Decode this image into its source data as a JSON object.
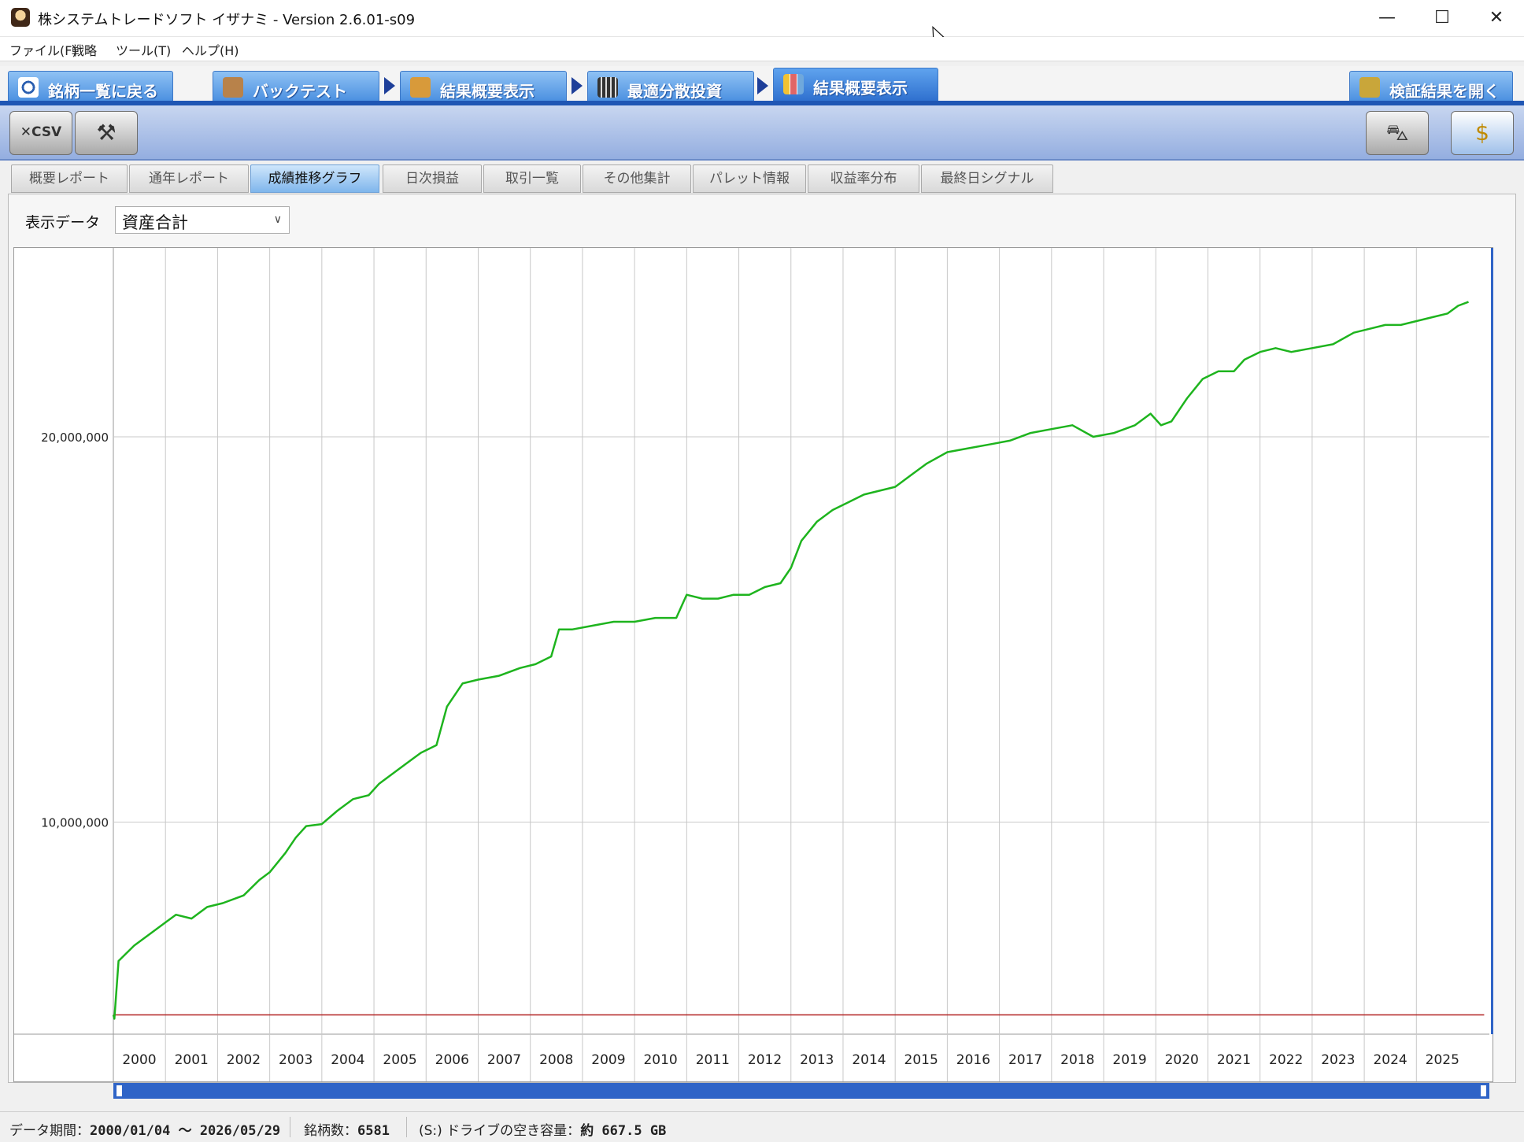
{
  "window": {
    "title": "株システムトレードソフト イザナミ - Version 2.6.01-s09",
    "minimize": "—",
    "maximize": "☐",
    "close": "✕"
  },
  "menu": [
    "ファイル(F)",
    "戦略",
    "ツール(T)",
    "ヘルプ(H)"
  ],
  "nav": {
    "back": "銘柄一覧に戻る",
    "backtest": "バックテスト",
    "summary1": "結果概要表示",
    "optimal": "最適分散投資",
    "summary2": "結果概要表示",
    "open_results": "検証結果を開く"
  },
  "toolbar": {
    "csv_icon": "csv-export-icon",
    "tools_icon": "tools-icon",
    "right1_icon": "chart-tool-icon",
    "right2_icon": "money-box-icon"
  },
  "subtabs": [
    "概要レポート",
    "通年レポート",
    "成績推移グラフ",
    "日次損益",
    "取引一覧",
    "その他集計",
    "パレット情報",
    "収益率分布",
    "最終日シグナル"
  ],
  "active_subtab": 2,
  "display": {
    "label": "表示データ",
    "value": "資産合計"
  },
  "chart_data": {
    "type": "line",
    "series": [
      {
        "color": "#1eb41e",
        "x": [
          2000.0,
          2000.02,
          2000.1,
          2000.4,
          2000.7,
          2001.0,
          2001.2,
          2001.5,
          2001.8,
          2002.1,
          2002.5,
          2002.8,
          2003.0,
          2003.3,
          2003.5,
          2003.7,
          2004.0,
          2004.3,
          2004.6,
          2004.9,
          2005.1,
          2005.4,
          2005.7,
          2005.9,
          2006.2,
          2006.4,
          2006.7,
          2007.0,
          2007.4,
          2007.8,
          2008.1,
          2008.4,
          2008.55,
          2008.8,
          2009.2,
          2009.6,
          2010.0,
          2010.4,
          2010.8,
          2011.0,
          2011.3,
          2011.6,
          2011.9,
          2012.2,
          2012.5,
          2012.8,
          2013.0,
          2013.2,
          2013.5,
          2013.8,
          2014.1,
          2014.4,
          2014.7,
          2015.0,
          2015.3,
          2015.6,
          2016.0,
          2016.4,
          2016.8,
          2017.2,
          2017.6,
          2018.0,
          2018.4,
          2018.8,
          2019.2,
          2019.6,
          2019.9,
          2020.1,
          2020.3,
          2020.6,
          2020.9,
          2021.2,
          2021.5,
          2021.7,
          2022.0,
          2022.3,
          2022.6,
          2023.0,
          2023.4,
          2023.8,
          2024.1,
          2024.4,
          2024.7,
          2025.0,
          2025.3,
          2025.6,
          2025.8,
          2026.0
        ],
        "y": [
          5000000,
          4900000,
          6400000,
          6800000,
          7100000,
          7400000,
          7600000,
          7500000,
          7800000,
          7900000,
          8100000,
          8500000,
          8700000,
          9200000,
          9600000,
          9900000,
          9950000,
          10300000,
          10600000,
          10700000,
          11000000,
          11300000,
          11600000,
          11800000,
          12000000,
          13000000,
          13600000,
          13700000,
          13800000,
          14000000,
          14100000,
          14300000,
          15000000,
          15000000,
          15100000,
          15200000,
          15200000,
          15300000,
          15300000,
          15900000,
          15800000,
          15800000,
          15900000,
          15900000,
          16100000,
          16200000,
          16600000,
          17300000,
          17800000,
          18100000,
          18300000,
          18500000,
          18600000,
          18700000,
          19000000,
          19300000,
          19600000,
          19700000,
          19800000,
          19900000,
          20100000,
          20200000,
          20300000,
          20000000,
          20100000,
          20300000,
          20600000,
          20300000,
          20400000,
          21000000,
          21500000,
          21700000,
          21700000,
          22000000,
          22200000,
          22300000,
          22200000,
          22300000,
          22400000,
          22700000,
          22800000,
          22900000,
          22900000,
          23000000,
          23100000,
          23200000,
          23400000,
          23500000
        ]
      },
      {
        "color": "#b22222",
        "x": [
          2000.0,
          2026.3
        ],
        "y": [
          5000000,
          5000000
        ]
      }
    ],
    "x_tick_labels": [
      "2000",
      "2001",
      "2002",
      "2003",
      "2004",
      "2005",
      "2006",
      "2007",
      "2008",
      "2009",
      "2010",
      "2011",
      "2012",
      "2013",
      "2014",
      "2015",
      "2016",
      "2017",
      "2018",
      "2019",
      "2020",
      "2021",
      "2022",
      "2023",
      "2024",
      "2025"
    ],
    "y_ticks": [
      10000000,
      20000000
    ],
    "y_tick_labels": [
      "10,000,000",
      "20,000,000"
    ],
    "xlim": [
      2000.0,
      2026.4
    ],
    "ylim": [
      4500000,
      24900000
    ],
    "grid": true
  },
  "status": {
    "period_label": "データ期間：",
    "period_value": "2000/01/04 〜 2026/05/29",
    "count_label": "銘柄数：",
    "count_value": "6581",
    "drive_label": "(S:) ドライブの空き容量：",
    "drive_value": "約 667.5 GB"
  }
}
